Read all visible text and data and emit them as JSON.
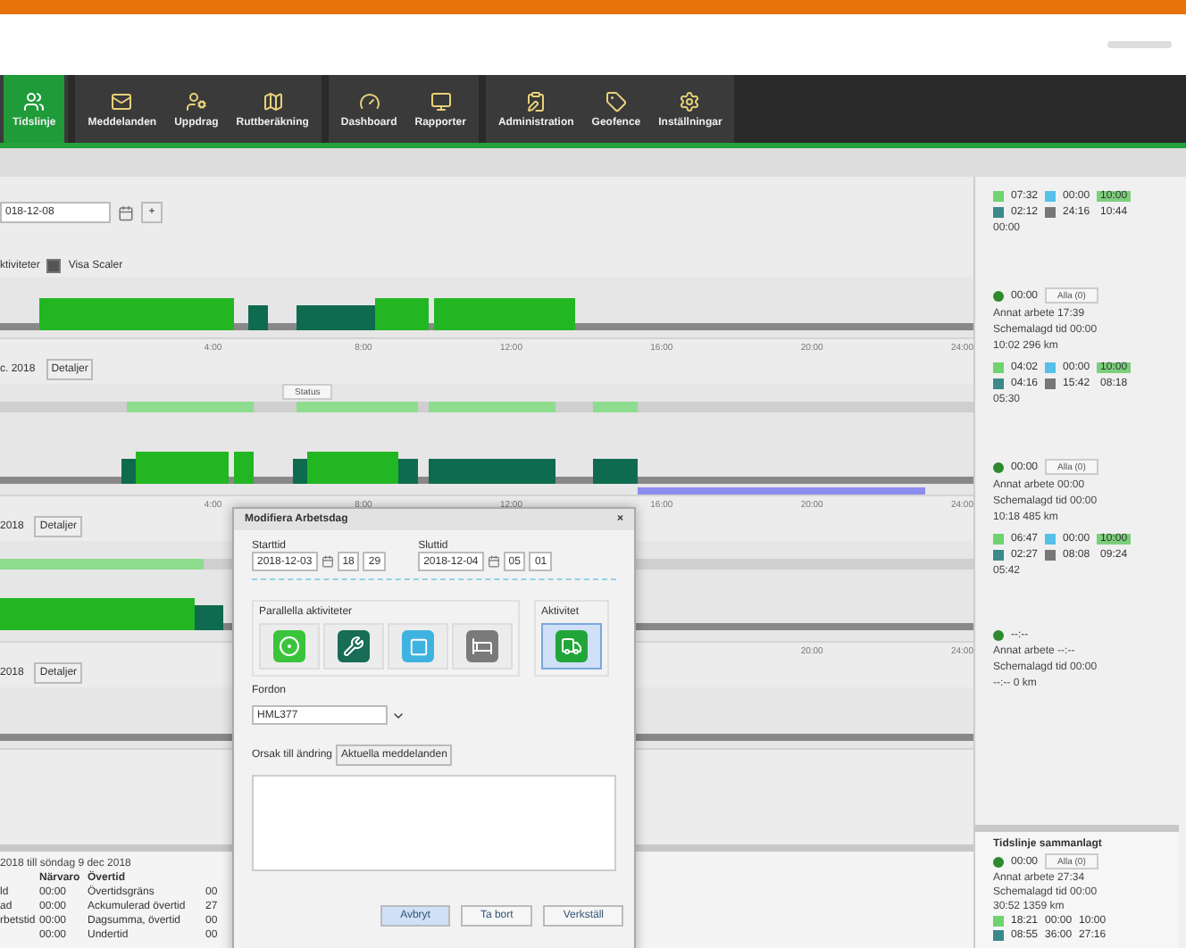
{
  "nav": {
    "groups": [
      [
        {
          "label": "Tidslinje",
          "selected": true
        }
      ],
      [
        {
          "label": "Meddelanden",
          "selected": false
        },
        {
          "label": "Uppdrag",
          "selected": false
        },
        {
          "label": "Ruttberäkning",
          "selected": false
        }
      ],
      [
        {
          "label": "Dashboard",
          "selected": false
        },
        {
          "label": "Rapporter",
          "selected": false
        }
      ],
      [
        {
          "label": "Administration",
          "selected": false
        },
        {
          "label": "Geofence",
          "selected": false
        },
        {
          "label": "Inställningar",
          "selected": false
        }
      ]
    ]
  },
  "date_field": {
    "value": "018-12-08"
  },
  "add_button": "+",
  "options": {
    "label": "ktiviteter",
    "show_scale": {
      "label": "Visa Scaler",
      "checked": true
    }
  },
  "axes": [
    [
      "4:00",
      "8:00",
      "12:00",
      "16:00",
      "20:00",
      "24:00"
    ],
    [
      "4:00",
      "8:00",
      "12:00",
      "16:00",
      "20:00",
      "24:00"
    ],
    [
      "20:00",
      "24:00"
    ]
  ],
  "days": [
    {
      "title": "c. 2018",
      "button": "Detaljer",
      "status_label": "Status"
    },
    {
      "title": "2018",
      "button": "Detaljer"
    },
    {
      "title": "2018",
      "button": "Detaljer"
    }
  ],
  "period_summary": {
    "title": "2018 till söndag 9 dec 2018",
    "columns": [
      "",
      "Närvaro",
      "Övertid"
    ],
    "rows": [
      [
        "ld",
        "00:00",
        "Övertidsgräns",
        "00"
      ],
      [
        "ad",
        "00:00",
        "Ackumulerad övertid",
        "27"
      ],
      [
        "rbetstid",
        "00:00",
        "Dagsumma, övertid",
        "00"
      ],
      [
        "",
        "00:00",
        "Undertid",
        "00"
      ]
    ]
  },
  "summary_panel": {
    "blocks": [
      {
        "kind": "times",
        "rows": [
          [
            "07:32",
            "00:00",
            "10:00"
          ],
          [
            "02:12",
            "24:16",
            "10:44"
          ]
        ],
        "footer": "00:00"
      },
      {
        "kind": "summary",
        "status": "00:00",
        "button": "Alla (0)",
        "lines": [
          "Annat arbete 17:39",
          "Schemalagd tid 00:00",
          "10:02  296 km"
        ]
      },
      {
        "kind": "times",
        "rows": [
          [
            "04:02",
            "00:00",
            "10:00"
          ],
          [
            "04:16",
            "15:42",
            "08:18"
          ]
        ],
        "footer": "05:30"
      },
      {
        "kind": "summary",
        "status": "00:00",
        "button": "Alla (0)",
        "lines": [
          "Annat arbete 00:00",
          "Schemalagd tid 00:00",
          "10:18  485 km"
        ]
      },
      {
        "kind": "times",
        "rows": [
          [
            "06:47",
            "00:00",
            "10:00"
          ],
          [
            "02:27",
            "08:08",
            "09:24"
          ]
        ],
        "footer": "05:42"
      },
      {
        "kind": "summary",
        "status": "--:--",
        "lines": [
          "Annat arbete --:--",
          "Schemalagd tid 00:00",
          "--:--  0 km"
        ]
      }
    ]
  },
  "total_panel": {
    "title": "Tidslinje sammanlagt",
    "status": "00:00",
    "button": "Alla (0)",
    "lines": [
      "Annat arbete 27:34",
      "Schemalagd tid 00:00",
      "30:52  1359 km"
    ],
    "rows": [
      [
        "18:21",
        "00:00",
        "10:00"
      ],
      [
        "08:55",
        "36:00",
        "27:16"
      ]
    ]
  },
  "dialog": {
    "title": "Modifiera Arbetsdag",
    "close": "×",
    "start": {
      "label": "Starttid",
      "date": "2018-12-03",
      "hour": "18",
      "minute": "29"
    },
    "end": {
      "label": "Sluttid",
      "date": "2018-12-04",
      "hour": "05",
      "minute": "01"
    },
    "parallel_label": "Parallella aktiviteter",
    "activity_label": "Aktivitet",
    "vehicle": {
      "label": "Fordon",
      "value": "HML377"
    },
    "reason": {
      "label": "Orsak till ändring",
      "button": "Aktuella meddelanden"
    },
    "buttons": [
      {
        "label": "Avbryt",
        "primary": true
      },
      {
        "label": "Ta bort",
        "primary": false
      },
      {
        "label": "Verkställ",
        "primary": false
      }
    ]
  }
}
